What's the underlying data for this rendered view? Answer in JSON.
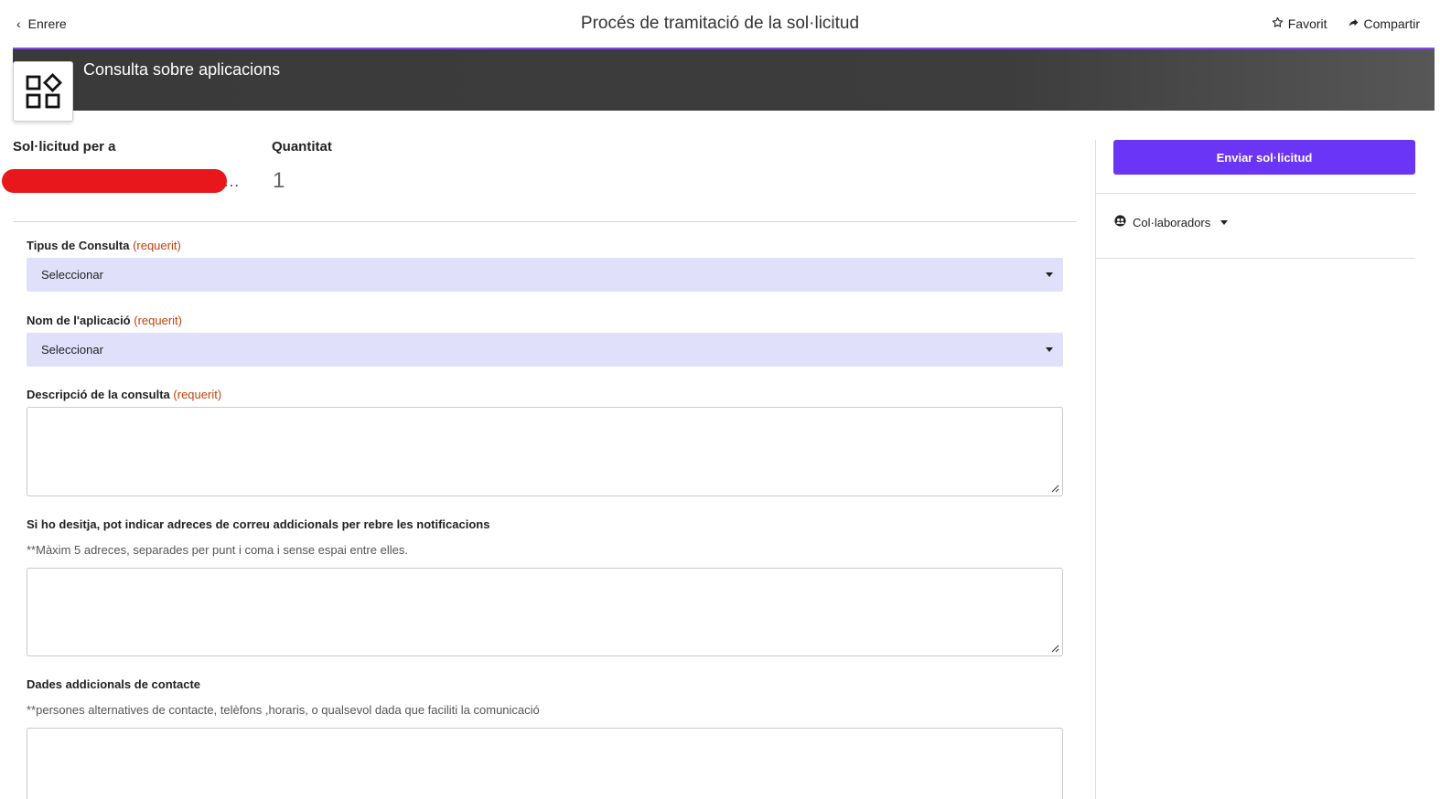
{
  "topbar": {
    "back_label": "Enrere",
    "title": "Procés de tramitació de la sol·licitud",
    "favorite_label": "Favorit",
    "share_label": "Compartir"
  },
  "header": {
    "title": "Consulta sobre aplicacions",
    "icon": "apps-grid-icon"
  },
  "summary": {
    "requested_for_label": "Sol·licitud per a",
    "requested_for_value": "…",
    "quantity_label": "Quantitat",
    "quantity_value": "1"
  },
  "form": {
    "required_tag": "(requerit)",
    "query_type": {
      "label": "Tipus de Consulta",
      "value": "Seleccionar"
    },
    "app_name": {
      "label": "Nom de l'aplicació",
      "value": "Seleccionar"
    },
    "description": {
      "label": "Descripció de la consulta",
      "value": ""
    },
    "extra_emails": {
      "label": "Si ho desitja, pot indicar adreces de correu addicionals per rebre les notificacions",
      "hint": "**Màxim 5 adreces, separades per punt i coma i sense espai entre elles.",
      "value": ""
    },
    "extra_contact": {
      "label": "Dades addicionals de contacte",
      "hint": "**persones alternatives de contacte, telèfons ,horaris, o qualsevol dada que faciliti la comunicació",
      "value": ""
    }
  },
  "sidebar": {
    "submit_label": "Enviar sol·licitud",
    "collaborators_label": "Col·laboradors"
  },
  "colors": {
    "accent": "#6b35f5",
    "select_bg": "#e0e0fb",
    "required": "#c2410c",
    "header_band": "#3d3d3d"
  }
}
